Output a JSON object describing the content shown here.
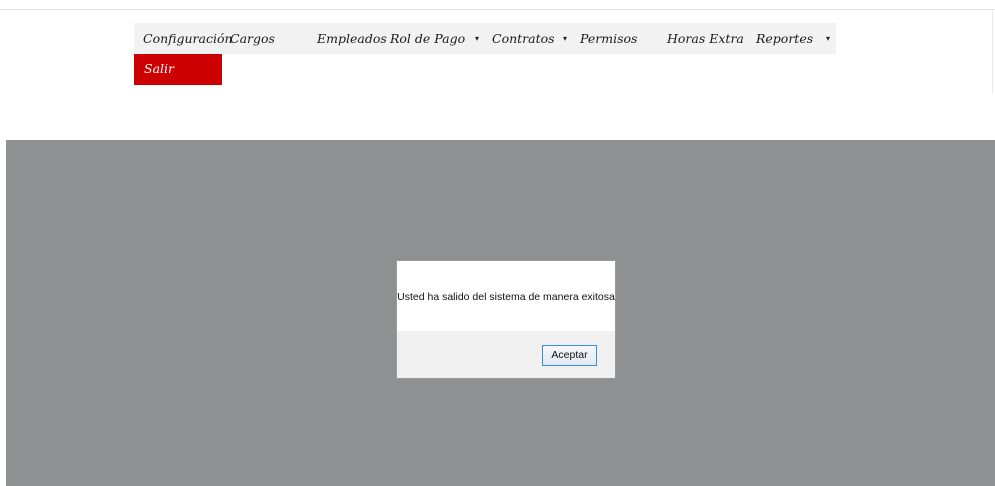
{
  "menu": {
    "items": [
      {
        "label": "Configuración"
      },
      {
        "label": "Cargos"
      },
      {
        "label": "Empleados"
      },
      {
        "label": "Rol de Pago",
        "has_dropdown": true
      },
      {
        "label": "Contratos",
        "has_dropdown": true
      },
      {
        "label": "Permisos"
      },
      {
        "label": "Horas Extra"
      },
      {
        "label": "Reportes",
        "has_dropdown": true
      }
    ],
    "caret_glyph": "▾",
    "logout_label": "Salir",
    "logout_color": "#cc0000"
  },
  "dialog": {
    "message": "Usted ha salido del sistema de manera exitosa",
    "button_label": "Aceptar"
  },
  "colors": {
    "overlay": "#8f9092",
    "menubar": "#f2f2f2",
    "button_border": "#3d8ee0"
  }
}
